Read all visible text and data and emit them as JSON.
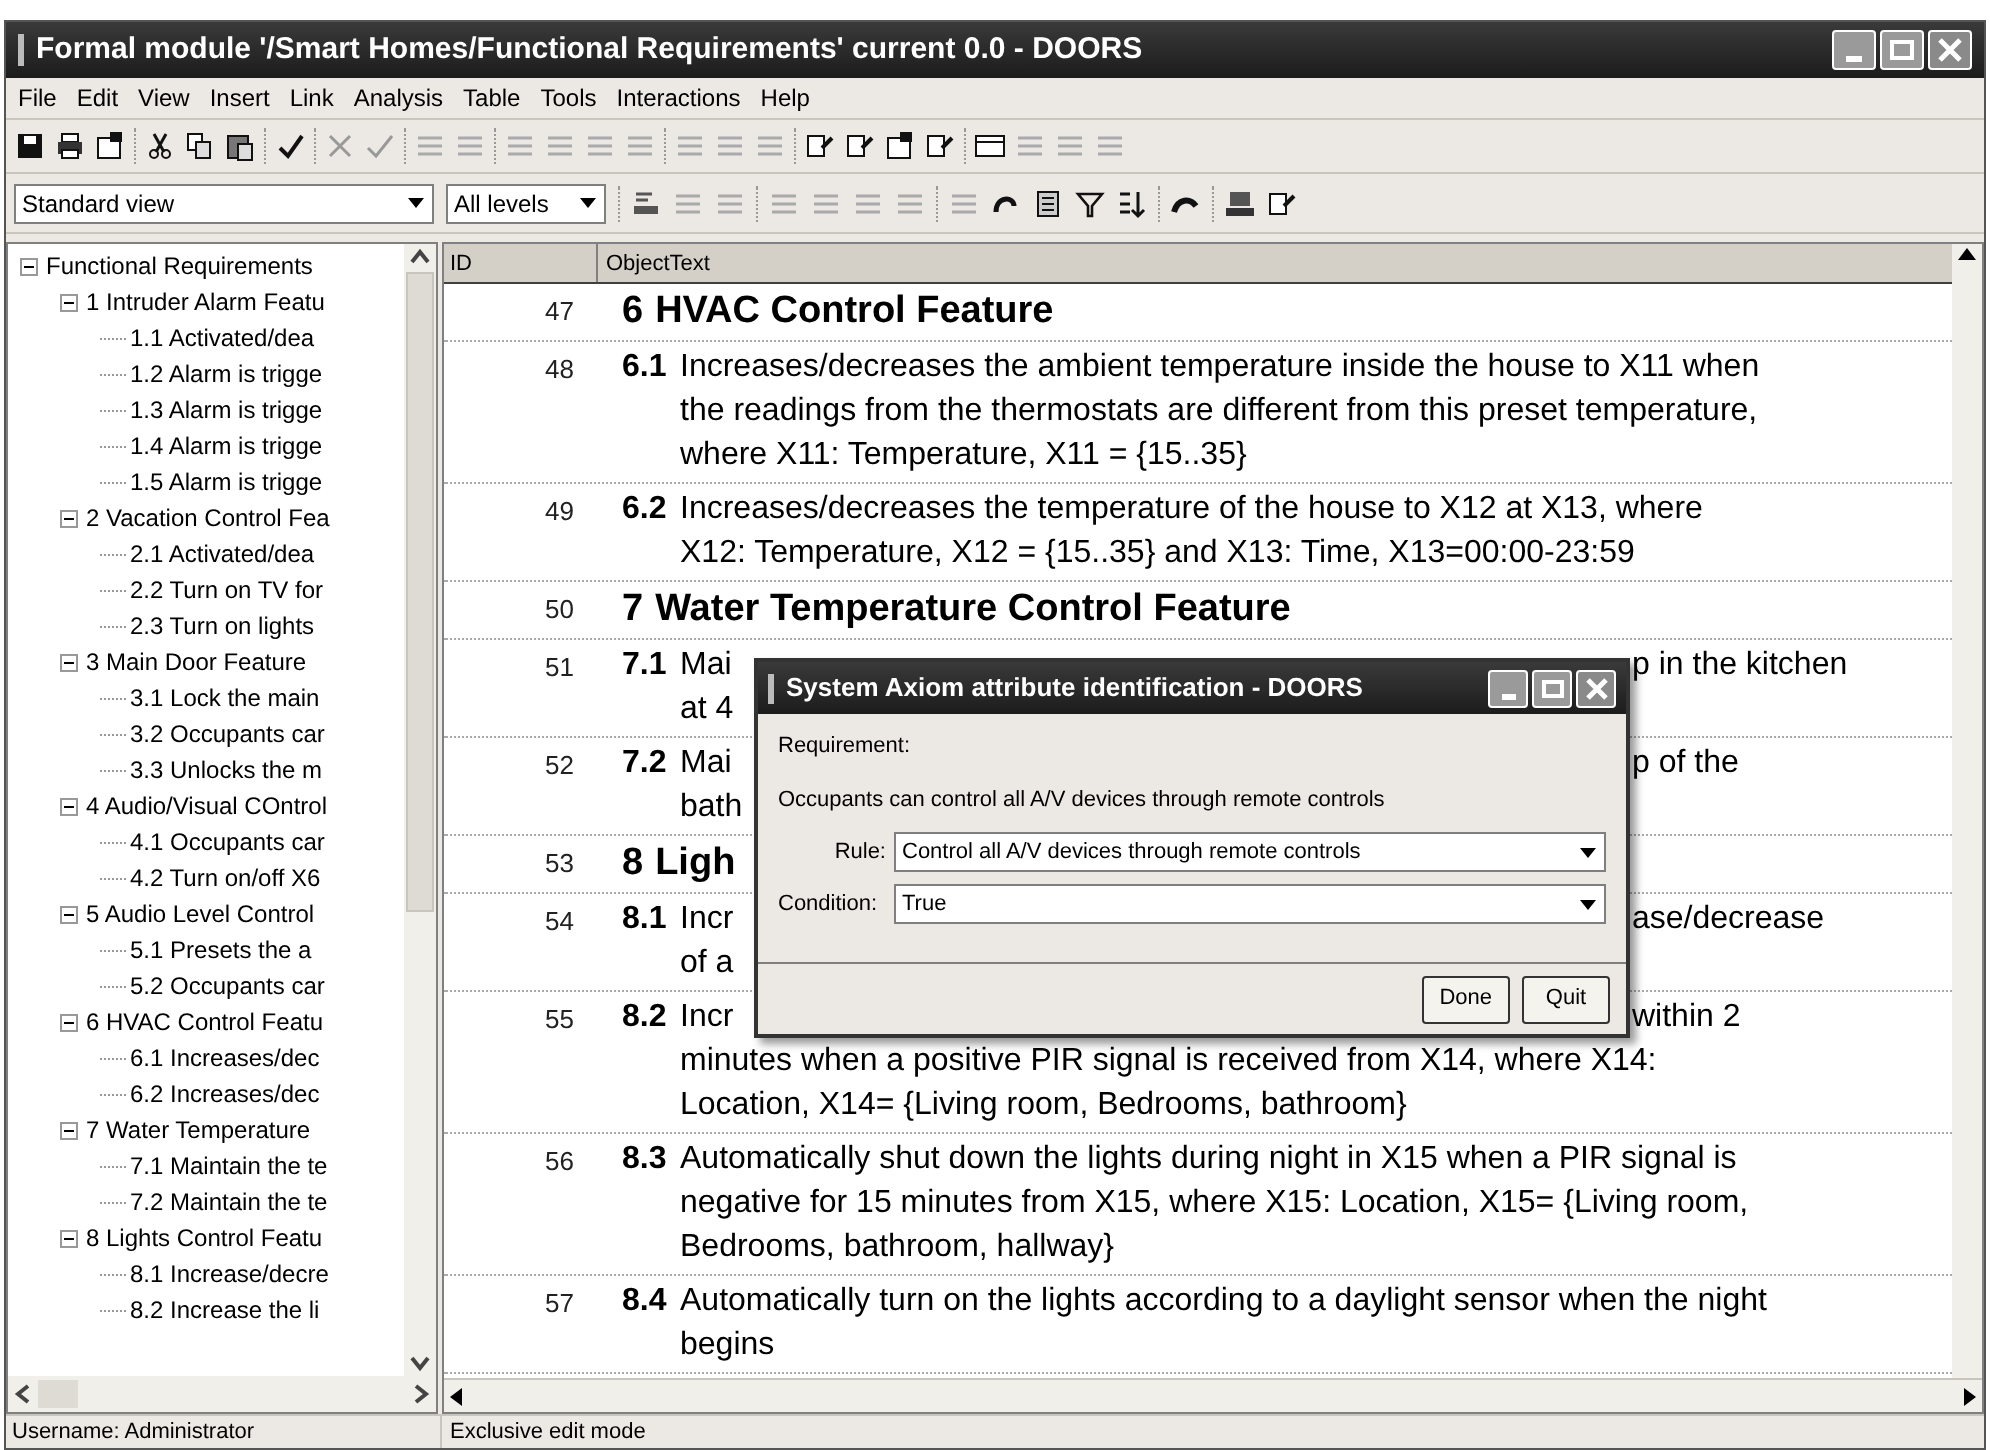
{
  "window": {
    "title": "Formal module '/Smart Homes/Functional Requirements' current 0.0 - DOORS"
  },
  "menu": [
    "File",
    "Edit",
    "View",
    "Insert",
    "Link",
    "Analysis",
    "Table",
    "Tools",
    "Interactions",
    "Help"
  ],
  "view_select": {
    "value": "Standard view"
  },
  "level_select": {
    "value": "All levels"
  },
  "tree": [
    {
      "label": "Functional Requirements",
      "expanded": true,
      "children": [
        {
          "label": "1 Intruder Alarm Featu",
          "expanded": true,
          "children": [
            {
              "label": "1.1  Activated/dea"
            },
            {
              "label": "1.2 Alarm is trigge"
            },
            {
              "label": "1.3 Alarm is trigge"
            },
            {
              "label": "1.4 Alarm is trigge"
            },
            {
              "label": "1.5  Alarm is trigge"
            }
          ]
        },
        {
          "label": "2 Vacation Control Fea",
          "expanded": true,
          "children": [
            {
              "label": "2.1 Activated/dea"
            },
            {
              "label": "2.2 Turn on TV for"
            },
            {
              "label": "2.3 Turn on lights"
            }
          ]
        },
        {
          "label": "3 Main Door Feature",
          "expanded": true,
          "children": [
            {
              "label": "3.1 Lock the main"
            },
            {
              "label": "3.2 Occupants car"
            },
            {
              "label": "3.3 Unlocks the m"
            }
          ]
        },
        {
          "label": "4 Audio/Visual COntrol",
          "expanded": true,
          "children": [
            {
              "label": "4.1 Occupants car"
            },
            {
              "label": "4.2 Turn on/off X6"
            }
          ]
        },
        {
          "label": "5 Audio Level Control",
          "expanded": true,
          "children": [
            {
              "label": "5.1  Presets the a"
            },
            {
              "label": "5.2 Occupants car"
            }
          ]
        },
        {
          "label": "6 HVAC Control Featu",
          "expanded": true,
          "children": [
            {
              "label": "6.1 Increases/dec"
            },
            {
              "label": "6.2 Increases/dec"
            }
          ]
        },
        {
          "label": "7 Water Temperature",
          "expanded": true,
          "children": [
            {
              "label": "7.1 Maintain the te"
            },
            {
              "label": "7.2 Maintain the te"
            }
          ]
        },
        {
          "label": "8 Lights Control Featu",
          "expanded": true,
          "children": [
            {
              "label": "8.1 Increase/decre"
            },
            {
              "label": "8.2 Increase the li"
            }
          ]
        }
      ]
    }
  ],
  "table": {
    "columns": [
      "ID",
      "ObjectText"
    ],
    "rows": [
      {
        "id": "47",
        "kind": "heading",
        "number": "6",
        "text": "HVAC Control Feature"
      },
      {
        "id": "48",
        "kind": "requirement",
        "number": "6.1",
        "lines": [
          "Increases/decreases the ambient temperature inside the house to X11 when",
          "the readings from the thermostats are different from this preset temperature,",
          "where X11: Temperature, X11 = {15..35}"
        ]
      },
      {
        "id": "49",
        "kind": "requirement",
        "number": "6.2",
        "lines": [
          "Increases/decreases the temperature of the house to X12 at X13, where",
          "X12: Temperature, X12 = {15..35} and X13: Time, X13=00:00-23:59"
        ]
      },
      {
        "id": "50",
        "kind": "heading",
        "number": "7",
        "text": "Water Temperature Control Feature"
      },
      {
        "id": "51",
        "kind": "requirement",
        "number": "7.1",
        "lines": [
          {
            "left": "Mai",
            "right": "p in the kitchen"
          },
          {
            "left": "at 4"
          }
        ]
      },
      {
        "id": "52",
        "kind": "requirement",
        "number": "7.2",
        "lines": [
          {
            "left": "Mai",
            "right": "p of the"
          },
          {
            "left": "bath"
          }
        ]
      },
      {
        "id": "53",
        "kind": "heading",
        "number": "8",
        "text": "Ligh"
      },
      {
        "id": "54",
        "kind": "requirement",
        "number": "8.1",
        "lines": [
          {
            "left": "Incr",
            "right": "ase/decrease"
          },
          {
            "left": "of a"
          }
        ]
      },
      {
        "id": "55",
        "kind": "requirement",
        "number": "8.2",
        "lines": [
          {
            "left": "Incr",
            "right": "within 2"
          },
          "minutes when a positive PIR signal is received from X14, where X14:",
          "Location, X14= {Living room, Bedrooms, bathroom}"
        ]
      },
      {
        "id": "56",
        "kind": "requirement",
        "number": "8.3",
        "lines": [
          "Automatically shut down the lights during night in X15 when a PIR signal is",
          "negative for 15 minutes from X15, where X15: Location, X15= {Living room,",
          "Bedrooms, bathroom, hallway}"
        ]
      },
      {
        "id": "57",
        "kind": "requirement",
        "number": "8.4",
        "lines": [
          "Automatically turn on the lights according to a daylight sensor when the night",
          "begins"
        ]
      }
    ]
  },
  "dialog": {
    "title": "System Axiom attribute identification - DOORS",
    "requirement_label": "Requirement:",
    "requirement_text": "Occupants can control all A/V devices through remote controls",
    "rule_label": "Rule:",
    "rule_value": "Control all A/V devices through remote controls",
    "condition_label": "Condition:",
    "condition_value": "True",
    "buttons": [
      "Done",
      "Quit"
    ]
  },
  "status_bar": [
    "Username: Administrator",
    "Exclusive edit mode"
  ]
}
